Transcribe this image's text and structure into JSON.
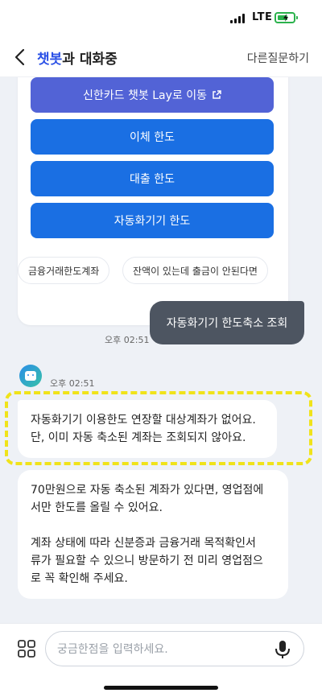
{
  "status_bar": {
    "network": "LTE"
  },
  "header": {
    "title_highlight": "챗봇",
    "title_rest": "과 대화중",
    "other_question": "다른질문하기"
  },
  "card": {
    "buttons": [
      {
        "label": "신한카드 챗봇 Lay로 이동",
        "icon": "external-link-icon"
      },
      {
        "label": "이체 한도"
      },
      {
        "label": "대출 한도"
      },
      {
        "label": "자동화기기 한도"
      }
    ]
  },
  "chips": [
    "금융거래한도계좌",
    "잔액이 있는데 출금이 안된다면"
  ],
  "user_message": {
    "text": "자동화기기 한도축소 조회",
    "time": "오후 02:51"
  },
  "bot": {
    "time": "오후 02:51",
    "message1_line1": "자동화기기 이용한도 연장할 대상계좌가 없어요.",
    "message1_line2": "단, 이미 자동 축소된 계좌는 조회되지 않아요.",
    "message2_para1_line1": "70만원으로 자동 축소된 계좌가 있다면, 영업점에",
    "message2_para1_line2": "서만 한도를 올릴 수 있어요.",
    "message2_para2_line1": "계좌 상태에 따라 신분증과 금융거래 목적확인서",
    "message2_para2_line2": "류가 필요할 수 있으니 방문하기 전 미리 영업점으",
    "message2_para2_line3": "로 꼭 확인해 주세요."
  },
  "input": {
    "placeholder": "궁금한점을 입력하세요."
  },
  "colors": {
    "accent": "#2a50e6",
    "button_blue": "#1a6fe3",
    "button_purple": "#5263d6",
    "highlight": "#f0e31a"
  }
}
